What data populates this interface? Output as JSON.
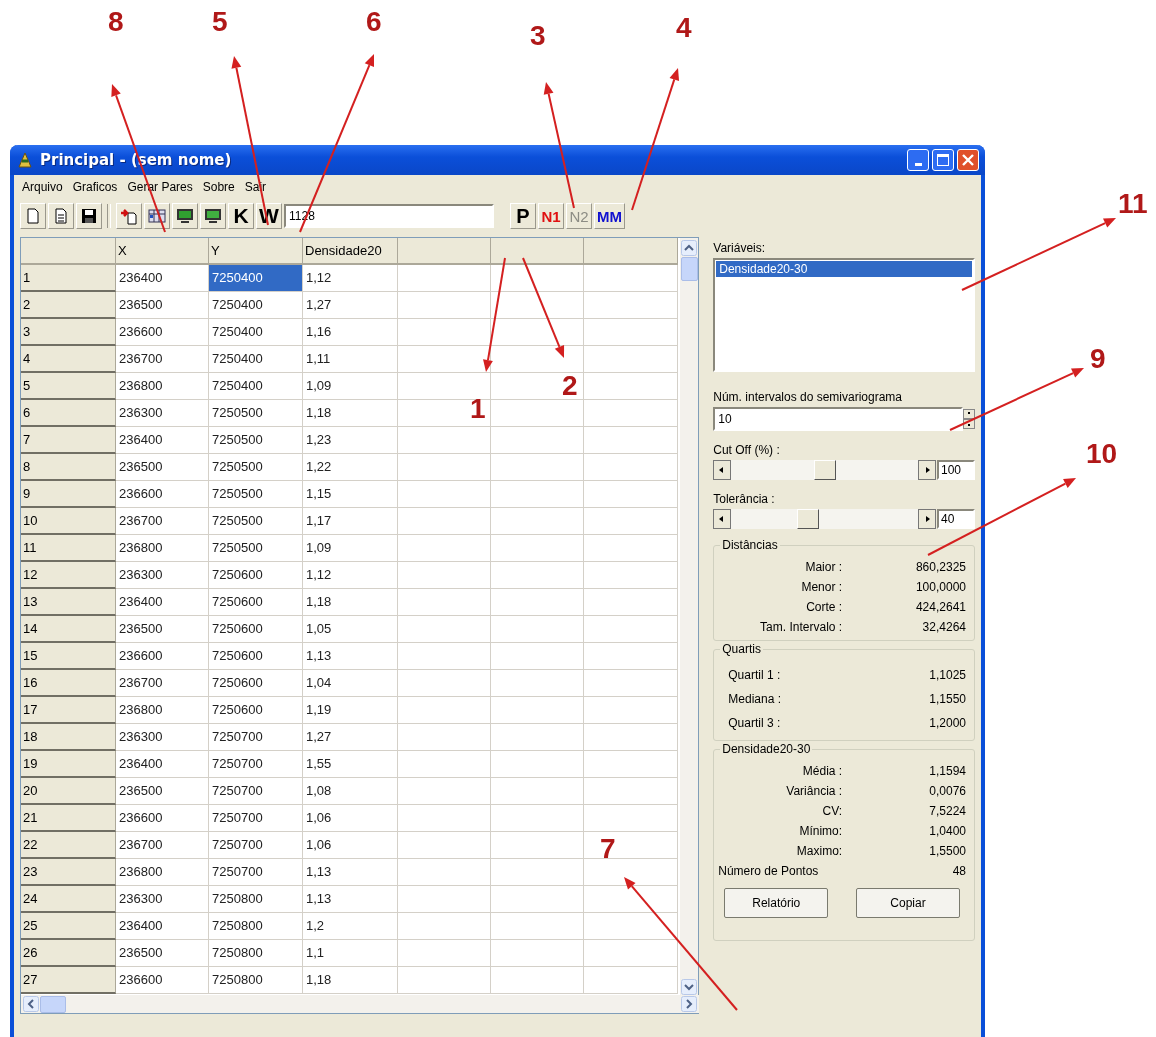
{
  "window": {
    "title": "Principal - (sem nome)"
  },
  "menu": [
    "Arquivo",
    "Graficos",
    "Gerar Pares",
    "Sobre",
    "Sair"
  ],
  "toolbar": {
    "letter_buttons": [
      {
        "label": "K"
      },
      {
        "label": "W"
      }
    ],
    "field": {
      "value": "1128"
    },
    "mode_buttons": [
      {
        "label": "P",
        "color": "#000000",
        "disabled": false
      },
      {
        "label": "N1",
        "color": "#e01010",
        "disabled": false
      },
      {
        "label": "N2",
        "disabled": true
      },
      {
        "label": "MM",
        "color": "#1010d0",
        "disabled": false
      }
    ]
  },
  "table": {
    "columns": [
      "X",
      "Y",
      "Densidade20"
    ],
    "rows": [
      {
        "number": "1",
        "cells": [
          {
            "text": "236400",
            "selected": false
          },
          {
            "text": "7250400",
            "selected": true
          },
          {
            "text": "1,12",
            "selected": false
          }
        ]
      },
      {
        "number": "2",
        "cells": [
          {
            "text": "236500",
            "selected": false
          },
          {
            "text": "7250400",
            "selected": false
          },
          {
            "text": "1,27",
            "selected": false
          }
        ]
      },
      {
        "number": "3",
        "cells": [
          {
            "text": "236600",
            "selected": false
          },
          {
            "text": "7250400",
            "selected": false
          },
          {
            "text": "1,16",
            "selected": false
          }
        ]
      },
      {
        "number": "4",
        "cells": [
          {
            "text": "236700",
            "selected": false
          },
          {
            "text": "7250400",
            "selected": false
          },
          {
            "text": "1,11",
            "selected": false
          }
        ]
      },
      {
        "number": "5",
        "cells": [
          {
            "text": "236800",
            "selected": false
          },
          {
            "text": "7250400",
            "selected": false
          },
          {
            "text": "1,09",
            "selected": false
          }
        ]
      },
      {
        "number": "6",
        "cells": [
          {
            "text": "236300",
            "selected": false
          },
          {
            "text": "7250500",
            "selected": false
          },
          {
            "text": "1,18",
            "selected": false
          }
        ]
      },
      {
        "number": "7",
        "cells": [
          {
            "text": "236400",
            "selected": false
          },
          {
            "text": "7250500",
            "selected": false
          },
          {
            "text": "1,23",
            "selected": false
          }
        ]
      },
      {
        "number": "8",
        "cells": [
          {
            "text": "236500",
            "selected": false
          },
          {
            "text": "7250500",
            "selected": false
          },
          {
            "text": "1,22",
            "selected": false
          }
        ]
      },
      {
        "number": "9",
        "cells": [
          {
            "text": "236600",
            "selected": false
          },
          {
            "text": "7250500",
            "selected": false
          },
          {
            "text": "1,15",
            "selected": false
          }
        ]
      },
      {
        "number": "10",
        "cells": [
          {
            "text": "236700",
            "selected": false
          },
          {
            "text": "7250500",
            "selected": false
          },
          {
            "text": "1,17",
            "selected": false
          }
        ]
      },
      {
        "number": "11",
        "cells": [
          {
            "text": "236800",
            "selected": false
          },
          {
            "text": "7250500",
            "selected": false
          },
          {
            "text": "1,09",
            "selected": false
          }
        ]
      },
      {
        "number": "12",
        "cells": [
          {
            "text": "236300",
            "selected": false
          },
          {
            "text": "7250600",
            "selected": false
          },
          {
            "text": "1,12",
            "selected": false
          }
        ]
      },
      {
        "number": "13",
        "cells": [
          {
            "text": "236400",
            "selected": false
          },
          {
            "text": "7250600",
            "selected": false
          },
          {
            "text": "1,18",
            "selected": false
          }
        ]
      },
      {
        "number": "14",
        "cells": [
          {
            "text": "236500",
            "selected": false
          },
          {
            "text": "7250600",
            "selected": false
          },
          {
            "text": "1,05",
            "selected": false
          }
        ]
      },
      {
        "number": "15",
        "cells": [
          {
            "text": "236600",
            "selected": false
          },
          {
            "text": "7250600",
            "selected": false
          },
          {
            "text": "1,13",
            "selected": false
          }
        ]
      },
      {
        "number": "16",
        "cells": [
          {
            "text": "236700",
            "selected": false
          },
          {
            "text": "7250600",
            "selected": false
          },
          {
            "text": "1,04",
            "selected": false
          }
        ]
      },
      {
        "number": "17",
        "cells": [
          {
            "text": "236800",
            "selected": false
          },
          {
            "text": "7250600",
            "selected": false
          },
          {
            "text": "1,19",
            "selected": false
          }
        ]
      },
      {
        "number": "18",
        "cells": [
          {
            "text": "236300",
            "selected": false
          },
          {
            "text": "7250700",
            "selected": false
          },
          {
            "text": "1,27",
            "selected": false
          }
        ]
      },
      {
        "number": "19",
        "cells": [
          {
            "text": "236400",
            "selected": false
          },
          {
            "text": "7250700",
            "selected": false
          },
          {
            "text": "1,55",
            "selected": false
          }
        ]
      },
      {
        "number": "20",
        "cells": [
          {
            "text": "236500",
            "selected": false
          },
          {
            "text": "7250700",
            "selected": false
          },
          {
            "text": "1,08",
            "selected": false
          }
        ]
      },
      {
        "number": "21",
        "cells": [
          {
            "text": "236600",
            "selected": false
          },
          {
            "text": "7250700",
            "selected": false
          },
          {
            "text": "1,06",
            "selected": false
          }
        ]
      },
      {
        "number": "22",
        "cells": [
          {
            "text": "236700",
            "selected": false
          },
          {
            "text": "7250700",
            "selected": false
          },
          {
            "text": "1,06",
            "selected": false
          }
        ]
      },
      {
        "number": "23",
        "cells": [
          {
            "text": "236800",
            "selected": false
          },
          {
            "text": "7250700",
            "selected": false
          },
          {
            "text": "1,13",
            "selected": false
          }
        ]
      },
      {
        "number": "24",
        "cells": [
          {
            "text": "236300",
            "selected": false
          },
          {
            "text": "7250800",
            "selected": false
          },
          {
            "text": "1,13",
            "selected": false
          }
        ]
      },
      {
        "number": "25",
        "cells": [
          {
            "text": "236400",
            "selected": false
          },
          {
            "text": "7250800",
            "selected": false
          },
          {
            "text": "1,2",
            "selected": false
          }
        ]
      },
      {
        "number": "26",
        "cells": [
          {
            "text": "236500",
            "selected": false
          },
          {
            "text": "7250800",
            "selected": false
          },
          {
            "text": "1,1",
            "selected": false
          }
        ]
      },
      {
        "number": "27",
        "cells": [
          {
            "text": "236600",
            "selected": false
          },
          {
            "text": "7250800",
            "selected": false
          },
          {
            "text": "1,18",
            "selected": false
          }
        ]
      }
    ]
  },
  "panel": {
    "variables": {
      "label": "Variáveis:",
      "items": [
        {
          "text": "Densidade20-30",
          "selected": true
        }
      ]
    },
    "intervals": {
      "label": "Núm. intervalos do semivariograma",
      "value": "10"
    },
    "cutoff": {
      "label": "Cut Off (%) :",
      "level": 0.5,
      "value": "100"
    },
    "tolerance": {
      "label": "Tolerância :",
      "level": 0.4,
      "value": "40"
    },
    "groups": [
      {
        "title": "Distâncias",
        "rows": [
          {
            "label": "Maior :",
            "value": "860,2325"
          },
          {
            "label": "Menor :",
            "value": "100,0000"
          },
          {
            "label": "Corte :",
            "value": "424,2641"
          },
          {
            "label": "Tam. Intervalo :",
            "value": "32,4264"
          }
        ]
      },
      {
        "title": "Quartis",
        "rows": [
          {
            "label": "Quartil 1 :",
            "value": "1,1025"
          },
          {
            "label": "Mediana :",
            "value": "1,1550"
          },
          {
            "label": "Quartil 3 :",
            "value": "1,2000"
          }
        ]
      },
      {
        "title": "Densidade20-30",
        "rows": [
          {
            "label": "Média :",
            "value": "1,1594"
          },
          {
            "label": "Variância :",
            "value": "0,0076"
          },
          {
            "label": "CV:",
            "value": "7,5224"
          },
          {
            "label": "Mínimo:",
            "value": "1,0400"
          },
          {
            "label": "Maximo:",
            "value": "1,5500"
          },
          {
            "label": "Número de Pontos",
            "value": "48"
          }
        ],
        "buttons": [
          "Relatório",
          "Copiar"
        ]
      }
    ]
  },
  "annotations": [
    {
      "label": "8"
    },
    {
      "label": "5"
    },
    {
      "label": "6"
    },
    {
      "label": "3"
    },
    {
      "label": "4"
    },
    {
      "label": "11"
    },
    {
      "label": "9"
    },
    {
      "label": "1"
    },
    {
      "label": "2"
    },
    {
      "label": "10"
    },
    {
      "label": "7"
    }
  ]
}
